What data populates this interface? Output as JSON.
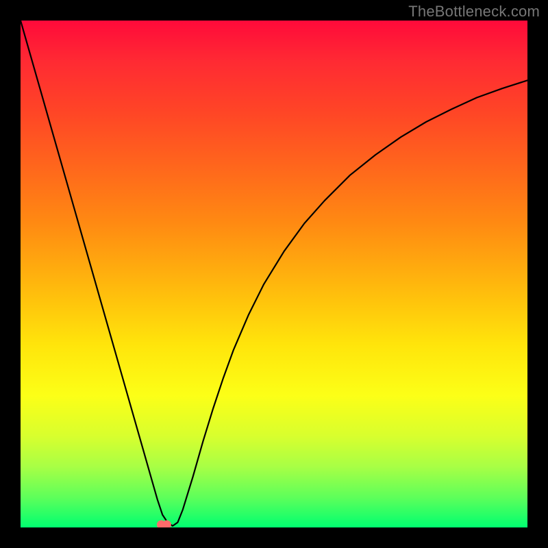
{
  "watermark": "TheBottleneck.com",
  "chart_data": {
    "type": "line",
    "title": "",
    "xlabel": "",
    "ylabel": "",
    "xlim": [
      0,
      100
    ],
    "ylim": [
      0,
      100
    ],
    "grid": false,
    "series": [
      {
        "name": "bottleneck-curve",
        "x": [
          0,
          2,
          4,
          6,
          8,
          10,
          12,
          14,
          16,
          18,
          20,
          22,
          24,
          26,
          27,
          28,
          29,
          30,
          31,
          32,
          34,
          36,
          38,
          40,
          42,
          45,
          48,
          52,
          56,
          60,
          65,
          70,
          75,
          80,
          85,
          90,
          95,
          100
        ],
        "y": [
          100,
          93,
          86,
          79,
          72,
          65,
          58,
          51,
          44,
          37,
          30,
          23,
          16,
          9,
          5.5,
          2.5,
          1,
          0.3,
          1,
          3.5,
          10,
          17,
          23.5,
          29.5,
          35,
          42,
          48,
          54.5,
          60,
          64.5,
          69.5,
          73.5,
          77,
          80,
          82.5,
          84.8,
          86.6,
          88.2
        ]
      }
    ],
    "marker": {
      "name": "optimal-point",
      "x": 28.3,
      "y": 0.0,
      "color": "#ff6b6b",
      "note": "two small overlapping dots at curve minimum"
    },
    "background": {
      "type": "vertical-gradient",
      "stops": [
        {
          "pos": 0.0,
          "color": "#ff0a3a"
        },
        {
          "pos": 0.5,
          "color": "#ffb70d"
        },
        {
          "pos": 0.74,
          "color": "#fcff17"
        },
        {
          "pos": 1.0,
          "color": "#00ff70"
        }
      ]
    }
  }
}
